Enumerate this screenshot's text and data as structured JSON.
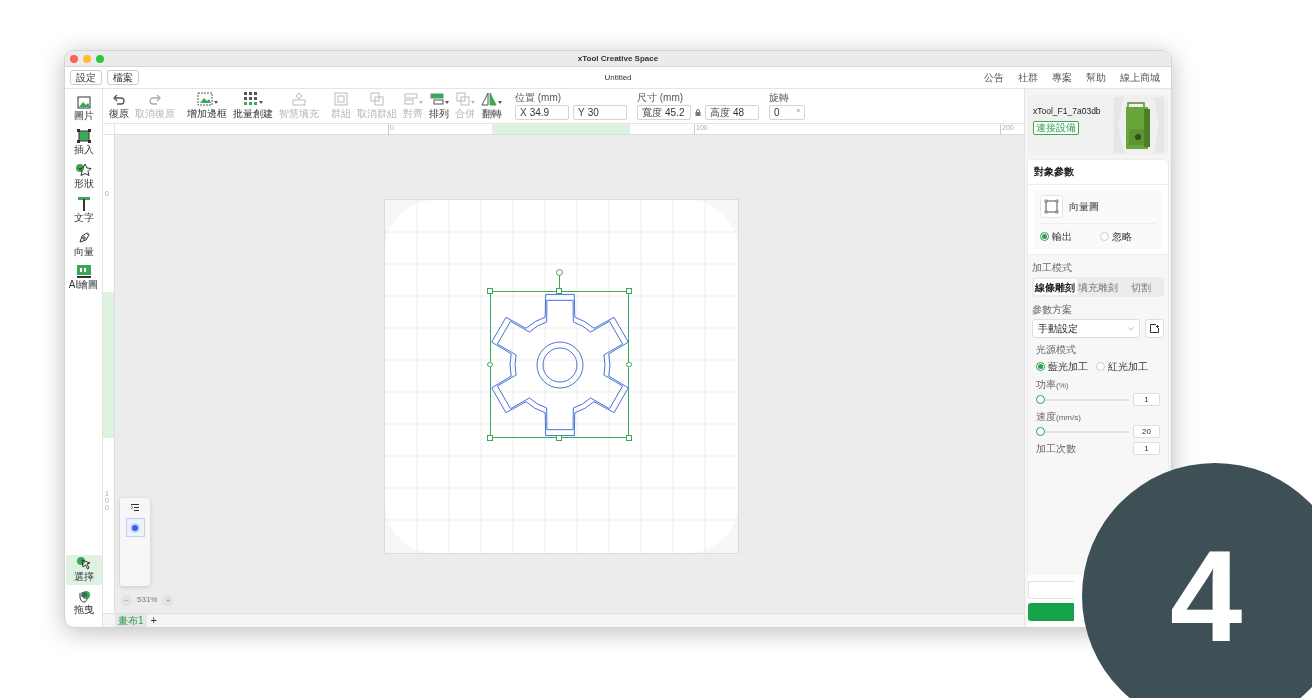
{
  "window": {
    "title": "xTool Creative Space"
  },
  "top_buttons": [
    "設定",
    "檔案"
  ],
  "document_title": "Untitled",
  "top_menu": [
    "公告",
    "社群",
    "專案",
    "幫助",
    "線上商城"
  ],
  "toolbar": [
    {
      "label": "復原",
      "disabled": false,
      "dropdown": false
    },
    {
      "label": "取消復原",
      "disabled": true,
      "dropdown": false
    },
    {
      "label": "增加邊框",
      "disabled": false,
      "dropdown": true
    },
    {
      "label": "批量創建",
      "disabled": false,
      "dropdown": true
    },
    {
      "label": "智慧填充",
      "disabled": true,
      "dropdown": false
    },
    {
      "label": "群組",
      "disabled": true,
      "dropdown": false
    },
    {
      "label": "取消群組",
      "disabled": true,
      "dropdown": false
    },
    {
      "label": "對齊",
      "disabled": true,
      "dropdown": true
    },
    {
      "label": "排列",
      "disabled": false,
      "dropdown": true
    },
    {
      "label": "合併",
      "disabled": true,
      "dropdown": true
    },
    {
      "label": "翻轉",
      "disabled": false,
      "dropdown": true
    }
  ],
  "geometry": [
    {
      "label": "位置 (mm)",
      "fields": [
        {
          "prefix": "X",
          "value": "34.9"
        },
        {
          "prefix": "Y",
          "value": "30"
        }
      ],
      "locked": false
    },
    {
      "label": "尺寸 (mm)",
      "fields": [
        {
          "prefix": "寬度",
          "value": "45.2"
        },
        {
          "prefix": "高度",
          "value": "48"
        }
      ],
      "locked": true
    },
    {
      "label": "旋轉",
      "fields": [
        {
          "value": "0",
          "unit": "°"
        }
      ],
      "locked": false
    }
  ],
  "ruler": {
    "top_labels": [
      "0",
      "100",
      "200"
    ],
    "left_labels": [
      "0",
      "100"
    ]
  },
  "sidebar": {
    "tools": [
      {
        "label": "圖片",
        "selected": false
      },
      {
        "label": "插入",
        "selected": false
      },
      {
        "label": "形狀",
        "selected": false
      },
      {
        "label": "文字",
        "selected": false
      },
      {
        "label": "向量",
        "selected": false
      },
      {
        "label": "AI繪圖",
        "selected": false
      }
    ],
    "bottom_tools": [
      {
        "label": "選擇",
        "selected": true
      },
      {
        "label": "拖曳",
        "selected": false
      }
    ]
  },
  "layers": [
    {
      "selected": true
    }
  ],
  "zoom": {
    "minus": "−",
    "value": "531%",
    "plus": "+"
  },
  "canvas_tabs": [
    {
      "label": "畫布1",
      "selected": true
    }
  ],
  "add_tab": "+",
  "device": {
    "name": "xTool_F1_7a03db",
    "badge": "連接設備"
  },
  "object_params": {
    "title": "對象參數",
    "object": "向量圖",
    "output": [
      {
        "label": "輸出",
        "selected": true
      },
      {
        "label": "忽略",
        "selected": false
      }
    ]
  },
  "process_mode": {
    "title": "加工模式",
    "options": [
      {
        "label": "線條雕刻",
        "selected": true
      },
      {
        "label": "填充雕刻",
        "selected": false
      },
      {
        "label": "切割",
        "selected": false
      }
    ]
  },
  "preset": {
    "title": "參數方案",
    "value": "手動設定"
  },
  "light_source": {
    "title": "光源模式",
    "options": [
      {
        "label": "藍光加工",
        "selected": true
      },
      {
        "label": "紅光加工",
        "selected": false
      }
    ]
  },
  "sliders": [
    {
      "label": "功率",
      "unit": "(%)",
      "level": 0,
      "value": "1"
    },
    {
      "label": "速度",
      "unit": "(mm/s)",
      "level": 0,
      "value": "20"
    }
  ],
  "passes": {
    "label": "加工次數",
    "value": "1"
  },
  "step_badge": {
    "label": "4"
  }
}
